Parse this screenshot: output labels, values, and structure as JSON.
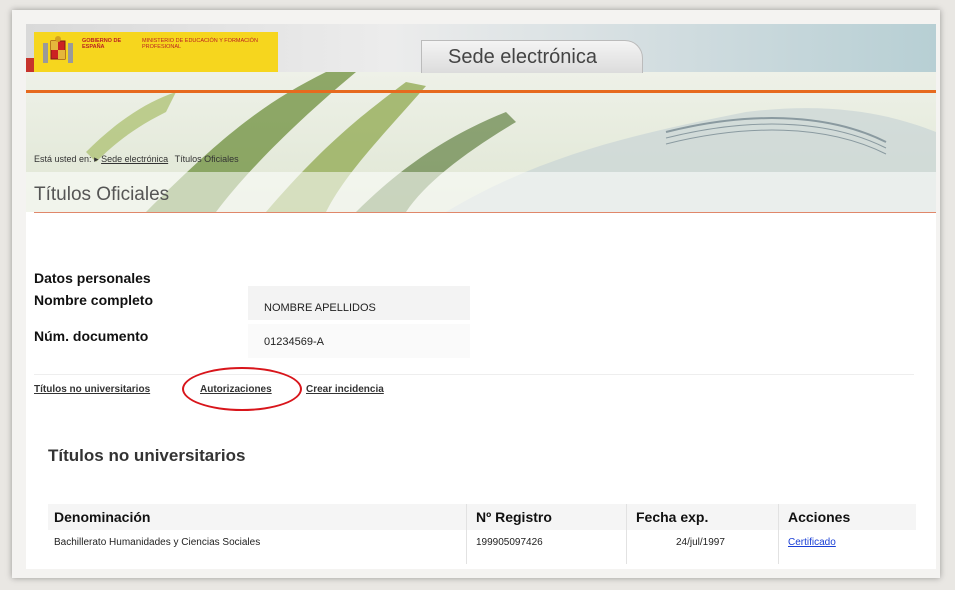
{
  "header": {
    "gov_name": "GOBIERNO DE ESPAÑA",
    "ministry": "MINISTERIO DE EDUCACIÓN Y FORMACIÓN PROFESIONAL",
    "site_title": "Sede electrónica"
  },
  "breadcrumb": {
    "prefix": "Está usted en:",
    "link": "Sede electrónica",
    "current": "Títulos Oficiales"
  },
  "page_title": "Títulos Oficiales",
  "personal": {
    "section_title": "Datos personales",
    "name_label": "Nombre completo",
    "name_value": "NOMBRE APELLIDOS",
    "doc_label": "Núm. documento",
    "doc_value": "01234569-A"
  },
  "tabs": [
    {
      "label": "Títulos no universitarios"
    },
    {
      "label": "Autorizaciones"
    },
    {
      "label": "Crear incidencia"
    }
  ],
  "titles_section": "Títulos no universitarios",
  "table": {
    "headers": [
      "Denominación",
      "Nº Registro",
      "Fecha exp.",
      "Acciones"
    ],
    "rows": [
      {
        "denominacion": "Bachillerato Humanidades y Ciencias Sociales",
        "registro": "199905097426",
        "fecha": "24/jul/1997",
        "accion": "Certificado"
      }
    ]
  },
  "colors": {
    "accent": "#e66a1e",
    "highlight_circle": "#d8151b",
    "link": "#1a3fd6"
  }
}
